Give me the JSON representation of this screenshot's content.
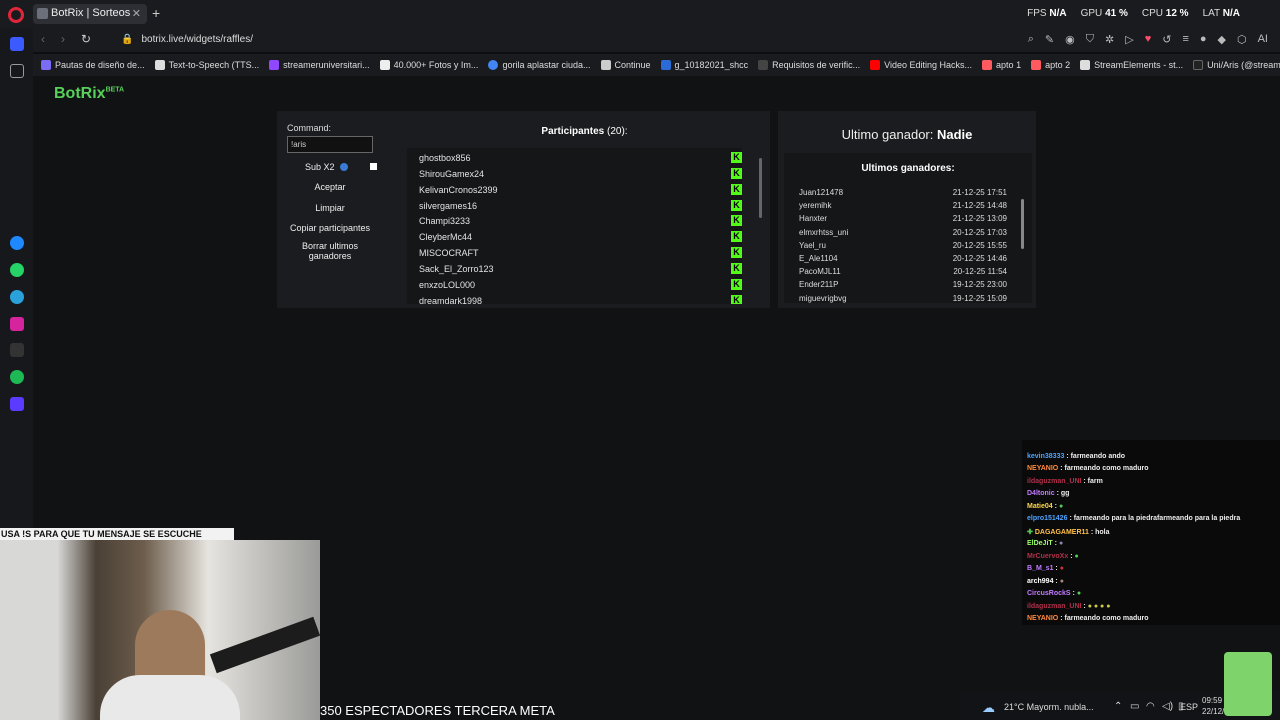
{
  "browser": {
    "tab_title": "BotRix | Sorteos",
    "url": "botrix.live/widgets/raffles/",
    "stats": {
      "fps_label": "FPS",
      "fps_val": "N/A",
      "gpu_label": "GPU",
      "gpu_val": "41 %",
      "cpu_label": "CPU",
      "cpu_val": "12 %",
      "lat_label": "LAT",
      "lat_val": "N/A"
    },
    "bookmarks": [
      "Pautas de diseño de...",
      "Text-to-Speech (TTS...",
      "streameruniversitari...",
      "40.000+ Fotos y Im...",
      "gorila aplastar ciuda...",
      "Continue",
      "g_10182021_shcc",
      "Requisitos de verific...",
      "Video Editing Hacks...",
      "apto 1",
      "apto 2",
      "StreamElements - st...",
      "Uni/Aris (@streame..."
    ],
    "colors": {
      "accent": "#57d15a",
      "kick_green": "#53fc18"
    }
  },
  "app": {
    "logo": "BotRix",
    "logo_badge": "BETA",
    "command_label": "Command:",
    "command_value": "!aris",
    "sub_label": "Sub X2",
    "buttons": {
      "accept": "Aceptar",
      "clear": "Limpiar",
      "copy": "Copiar participantes",
      "delete": "Borrar ultimos ganadores"
    },
    "participants_label": "Participantes",
    "participants_count": "(20):",
    "participants": [
      "ghostbox856",
      "ShirouGamex24",
      "KelivanCronos2399",
      "silvergames16",
      "Champi3233",
      "CleyberMc44",
      "MISCOCRAFT",
      "Sack_El_Zorro123",
      "enxzoLOL000",
      "dreamdark1998"
    ],
    "last_winner_label": "Ultimo ganador:",
    "last_winner_value": "Nadie",
    "winners_title": "Ultimos ganadores:",
    "winners": [
      {
        "name": "Juan121478",
        "date": "21-12-25 17:51"
      },
      {
        "name": "yeremihk",
        "date": "21-12-25 14:48"
      },
      {
        "name": "Hanxter",
        "date": "21-12-25 13:09"
      },
      {
        "name": "elmxrhtss_uni",
        "date": "20-12-25 17:03"
      },
      {
        "name": "Yael_ru",
        "date": "20-12-25 15:55"
      },
      {
        "name": "E_Ale1104",
        "date": "20-12-25 14:46"
      },
      {
        "name": "PacoMJL11",
        "date": "20-12-25 11:54"
      },
      {
        "name": "Ender211P",
        "date": "19-12-25 23:00"
      },
      {
        "name": "miguevrigbvg",
        "date": "19-12-25 15:09"
      }
    ]
  },
  "overlay": {
    "cam_banner": "USA !S PARA QUE TU MENSAJE SE ESCUCHE",
    "ticker": "350 ESPECTADORES TERCERA META",
    "chat": [
      {
        "user": "kevin38333",
        "msg": ": farmeando ando",
        "color": "#4fa3ff"
      },
      {
        "user": "NEYANIO",
        "msg": ": farmeando como maduro",
        "color": "#ff8a3d"
      },
      {
        "user": "ildaguzman_UNI",
        "msg": ": farm",
        "color": "#b0304a"
      },
      {
        "user": "D4ltonic",
        "msg": ": gg",
        "color": "#c27bff"
      },
      {
        "user": "Matie04",
        "msg": ":",
        "color": "#ffd84a"
      },
      {
        "user": "elpro151426",
        "msg": ": farmeando para la piedrafarmeando para la piedra",
        "color": "#4fa3ff"
      },
      {
        "user": "DAGAGAMER11",
        "msg": ": hola",
        "color": "#ffc04a"
      },
      {
        "user": "ElDeJiT",
        "msg": ":",
        "color": "#9aff6a"
      },
      {
        "user": "MrCuervoXx",
        "msg": ":",
        "color": "#b0304a"
      },
      {
        "user": "B_M_s1",
        "msg": ":",
        "color": "#c27bff"
      },
      {
        "user": "arch994",
        "msg": ":",
        "color": "#ffffff"
      },
      {
        "user": "CircusRockS",
        "msg": ":",
        "color": "#c27bff"
      },
      {
        "user": "ildaguzman_UNI",
        "msg": ":",
        "color": "#b0304a"
      },
      {
        "user": "NEYANIO",
        "msg": ": farmeando como maduro",
        "color": "#ff8a3d"
      }
    ],
    "weather": "21°C Mayorm. nubla...",
    "lang": "ESP",
    "time": "09:59",
    "date": "22/12/..."
  }
}
